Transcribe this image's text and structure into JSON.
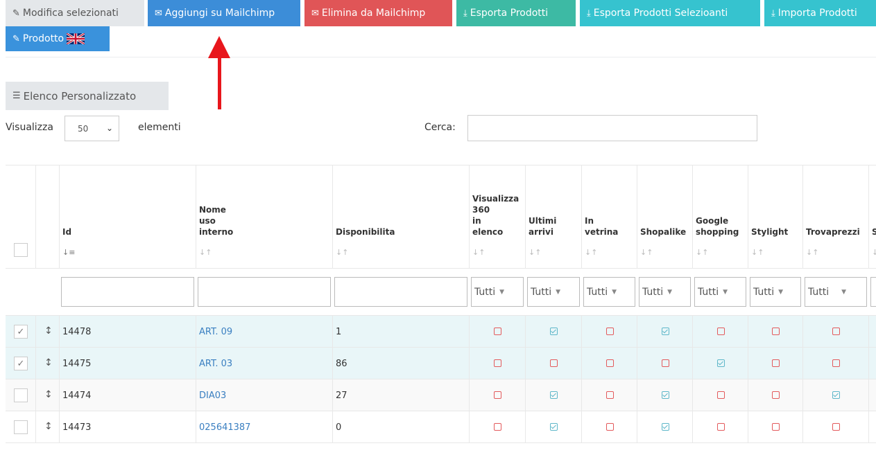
{
  "toolbar": {
    "modifica": "Modifica selezionati",
    "aggiungi": "Aggiungi su Mailchimp",
    "elimina": "Elimina da Mailchimp",
    "esporta": "Esporta Prodotti",
    "esporta_sel": "Esporta Prodotti Selezioanti",
    "importa": "Importa Prodotti",
    "prodotto": "Prodotto"
  },
  "elenco_label": "Elenco Personalizzato",
  "length": {
    "prefix": "Visualizza",
    "value": "50",
    "suffix": "elementi"
  },
  "search": {
    "label": "Cerca:",
    "value": ""
  },
  "columns": {
    "id": "Id",
    "nome": "Nome\nuso\ninterno",
    "disp": "Disponibilita",
    "vis360": "Visualizza\n360\nin\nelenco",
    "ultimi": "Ultimi\narrivi",
    "vetrina": "In\nvetrina",
    "shopalike": "Shopalike",
    "google": "Google\nshopping",
    "stylight": "Stylight",
    "trovaprezzi": "Trovaprezzi",
    "next": "S"
  },
  "filters": {
    "tutti": "Tutti"
  },
  "rows": [
    {
      "id": "14478",
      "nome": "ART. 09",
      "disp": "1",
      "selected": true,
      "flags": [
        false,
        true,
        false,
        true,
        false,
        false,
        false
      ]
    },
    {
      "id": "14475",
      "nome": "ART. 03",
      "disp": "86",
      "selected": true,
      "flags": [
        false,
        false,
        false,
        false,
        true,
        false,
        false
      ]
    },
    {
      "id": "14474",
      "nome": "DIA03",
      "disp": "27",
      "selected": false,
      "flags": [
        false,
        true,
        false,
        true,
        false,
        false,
        true
      ]
    },
    {
      "id": "14473",
      "nome": "025641387",
      "disp": "0",
      "selected": false,
      "flags": [
        false,
        true,
        false,
        true,
        false,
        false,
        false
      ]
    }
  ],
  "colors": {
    "accent_red": "#e8161c",
    "mailchimp_blue": "#3c8dd8",
    "delete_red": "#e05557",
    "teal": "#3dbaa4",
    "cyan": "#36c3cf"
  }
}
